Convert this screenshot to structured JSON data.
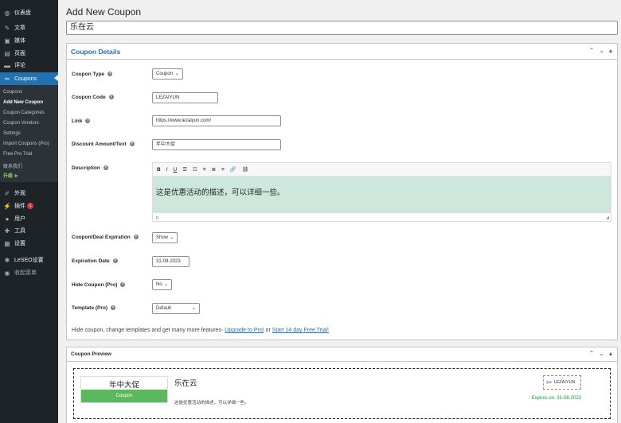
{
  "sidebar": {
    "top_items": [
      {
        "icon": "dashboard-icon",
        "glyph": "◍",
        "label": "仪表盘"
      },
      {
        "icon": "pin-icon",
        "glyph": "✎",
        "label": "文章"
      },
      {
        "icon": "media-icon",
        "glyph": "▣",
        "label": "媒体"
      },
      {
        "icon": "pages-icon",
        "glyph": "▤",
        "label": "页面"
      },
      {
        "icon": "comments-icon",
        "glyph": "▬",
        "label": "评论"
      }
    ],
    "active_item": {
      "icon": "scissors-icon",
      "glyph": "✂",
      "label": "Coupons"
    },
    "sub_items": [
      "Coupons",
      "Add New Coupon",
      "Coupon Categories",
      "Coupon Vendors",
      "Settings",
      "Import Coupons (Pro)",
      "Free Pro Trial",
      "联系我们",
      "升级 ➤"
    ],
    "bottom_items": [
      {
        "icon": "appearance-icon",
        "glyph": "✐",
        "label": "外观"
      },
      {
        "icon": "plugins-icon",
        "glyph": "⚡",
        "label": "插件",
        "badge": "1"
      },
      {
        "icon": "users-icon",
        "glyph": "●",
        "label": "用户"
      },
      {
        "icon": "tools-icon",
        "glyph": "✚",
        "label": "工具"
      },
      {
        "icon": "settings-icon",
        "glyph": "▦",
        "label": "设置"
      },
      {
        "icon": "gear-icon",
        "glyph": "✱",
        "label": "LeSEO设置"
      },
      {
        "icon": "collapse-icon",
        "glyph": "◉",
        "label": "收起菜单"
      }
    ]
  },
  "page": {
    "title": "Add New Coupon",
    "coupon_title_value": "乐在云"
  },
  "details": {
    "title": "Coupon Details",
    "coupon_type_label": "Coupon Type",
    "coupon_type_value": "Coupon",
    "coupon_code_label": "Coupon Code",
    "coupon_code_value": "LEZAIYUN",
    "link_label": "Link",
    "link_value": "https://www.lezaiyun.com/",
    "discount_label": "Discount Amount/Text",
    "discount_value": "年中大促",
    "description_label": "Description",
    "description_text": "这是优惠活动的描述，可以详细一些。",
    "editor_path": "p",
    "toolbar": [
      "B",
      "I",
      "U",
      "☰",
      "☷",
      "≡",
      "≣",
      "≡",
      "🔗",
      "⛓"
    ],
    "expiration_toggle_label": "Coupon/Deal Expiration",
    "expiration_toggle_value": "Show",
    "expiration_date_label": "Expiration Date",
    "expiration_date_value": "31-08-2023",
    "hide_coupon_label": "Hide Coupon (Pro)",
    "hide_coupon_value": "No",
    "template_label": "Template (Pro)",
    "template_value": "Default",
    "note_prefix": "Hide coupon, change templates and get many more features- ",
    "note_link1": "Upgrade to Pro!",
    "note_or": " or ",
    "note_link2": "Start 14 day Free Trial!"
  },
  "preview": {
    "title": "Coupon Preview",
    "deal": "年中大促",
    "button": "Coupon",
    "coupon_title": "乐在云",
    "description": "这是优惠活动的描述，可以详细一些。",
    "logo_text": "LEZAIYUN",
    "expires": "Expires on: 31-08-2023"
  },
  "colors": {
    "accent": "#2271b1",
    "sidebar": "#1d2327",
    "editor_bg": "#cde7dd",
    "coupon_button": "#5cb85c"
  }
}
